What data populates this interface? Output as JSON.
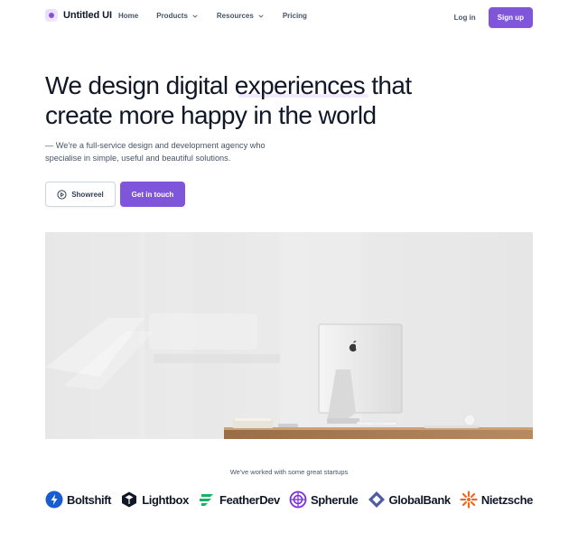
{
  "nav": {
    "brand": "Untitled UI",
    "links": [
      {
        "label": "Home"
      },
      {
        "label": "Products"
      },
      {
        "label": "Resources"
      },
      {
        "label": "Pricing"
      }
    ],
    "login": "Log in",
    "signup": "Sign up"
  },
  "hero": {
    "headline_line1": "We design digital experiences that",
    "headline_line2": "create more happy in the world",
    "subtext": "— We're a full-service design and development agency who specialise in simple, useful and beautiful solutions.",
    "showreel_label": "Showreel",
    "cta_label": "Get in touch"
  },
  "logos": {
    "caption": "We've worked with some great startups",
    "companies": [
      {
        "name": "Boltshift",
        "icon": "bolt-icon"
      },
      {
        "name": "Lightbox",
        "icon": "cube-icon"
      },
      {
        "name": "FeatherDev",
        "icon": "feather-icon"
      },
      {
        "name": "Spherule",
        "icon": "sphere-icon"
      },
      {
        "name": "GlobalBank",
        "icon": "diamond-icon"
      },
      {
        "name": "Nietzsche",
        "icon": "sunburst-icon"
      }
    ]
  },
  "colors": {
    "accent": "#7f56d9",
    "text_primary": "#101828",
    "text_secondary": "#475467",
    "border": "#d0d5dd"
  }
}
